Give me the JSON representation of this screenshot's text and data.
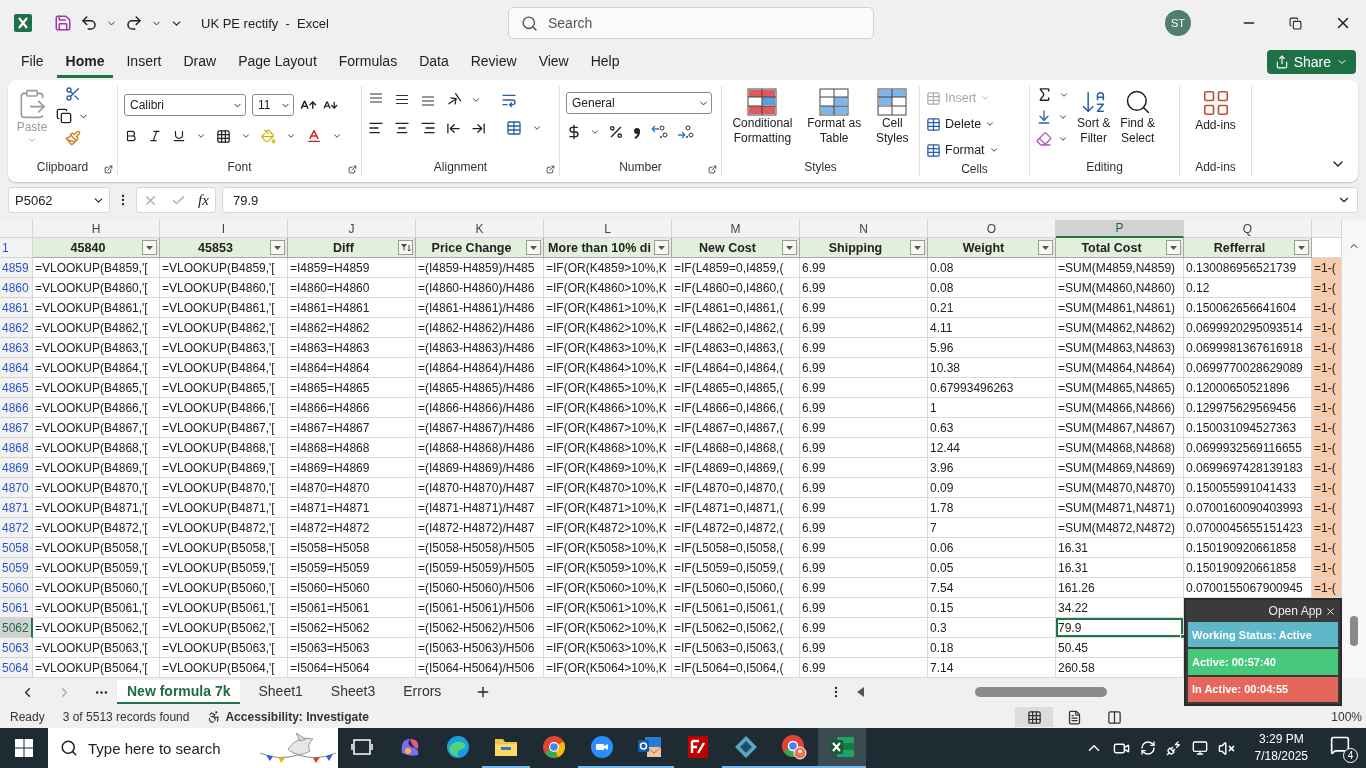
{
  "title_bar": {
    "document_title": "UK PE rectify  -  Excel",
    "search_placeholder": "Search",
    "avatar": "ST"
  },
  "menu_tabs": [
    {
      "label": "File",
      "selected": false
    },
    {
      "label": "Home",
      "selected": true
    },
    {
      "label": "Insert",
      "selected": false
    },
    {
      "label": "Draw",
      "selected": false
    },
    {
      "label": "Page Layout",
      "selected": false
    },
    {
      "label": "Formulas",
      "selected": false
    },
    {
      "label": "Data",
      "selected": false
    },
    {
      "label": "Review",
      "selected": false
    },
    {
      "label": "View",
      "selected": false
    },
    {
      "label": "Help",
      "selected": false
    }
  ],
  "share_button": "Share",
  "ribbon": {
    "clipboard": {
      "paste": "Paste",
      "label": "Clipboard"
    },
    "font": {
      "name": "Calibri",
      "size": "11",
      "label": "Font"
    },
    "alignment": {
      "label": "Alignment"
    },
    "number": {
      "format": "General",
      "label": "Number"
    },
    "styles": {
      "label": "Styles",
      "buttons": [
        {
          "kind": "conditional",
          "lines": [
            "Conditional",
            "Formatting"
          ]
        },
        {
          "kind": "table",
          "lines": [
            "Format as",
            "Table"
          ]
        },
        {
          "kind": "cell",
          "lines": [
            "Cell",
            "Styles"
          ]
        }
      ]
    },
    "cells": {
      "label": "Cells",
      "buttons": [
        {
          "label": "Insert",
          "disabled": true
        },
        {
          "label": "Delete",
          "disabled": false
        },
        {
          "label": "Format",
          "disabled": false
        }
      ]
    },
    "editing": {
      "label": "Editing",
      "buttons": [
        {
          "kind": "sort",
          "lines": [
            "Sort &",
            "Filter"
          ]
        },
        {
          "kind": "find",
          "lines": [
            "Find &",
            "Select"
          ]
        }
      ]
    },
    "add_ins": {
      "button": "Add-ins",
      "label": "Add-ins"
    }
  },
  "formula_bar": {
    "name_box": "P5062",
    "fx": "fx",
    "value": "79.9"
  },
  "sheet": {
    "header_row_number": "1",
    "columns": [
      {
        "letter": "H",
        "header": "45840",
        "filtered": false,
        "selected": false
      },
      {
        "letter": "I",
        "header": "45853",
        "filtered": false,
        "selected": false
      },
      {
        "letter": "J",
        "header": "Diff",
        "filtered": true,
        "selected": false
      },
      {
        "letter": "K",
        "header": "Price Change",
        "filtered": false,
        "selected": false
      },
      {
        "letter": "L",
        "header": "More than 10% di",
        "filtered": false,
        "selected": false
      },
      {
        "letter": "M",
        "header": "New Cost",
        "filtered": false,
        "selected": false
      },
      {
        "letter": "N",
        "header": "Shipping",
        "filtered": false,
        "selected": false
      },
      {
        "letter": "O",
        "header": "Weight",
        "filtered": false,
        "selected": false
      },
      {
        "letter": "P",
        "header": "Total Cost",
        "filtered": false,
        "selected": true
      },
      {
        "letter": "Q",
        "header": "Refferral",
        "filtered": false,
        "selected": false
      },
      {
        "color": "#f8cbad",
        "selected": false
      }
    ],
    "rows": [
      {
        "number": "4859",
        "selected": false,
        "cells": [
          "=VLOOKUP(B4859,'[",
          "=VLOOKUP(B4859,'[",
          "=I4859=H4859",
          "=(I4859-H4859)/H485",
          "=IF(OR(K4859>10%,K",
          "=IF(L4859=0,I4859,(",
          "6.99",
          "0.08",
          "=SUM(M4859,N4859)",
          "0.130086956521739",
          "=1-("
        ]
      },
      {
        "number": "4860",
        "selected": false,
        "cells": [
          "=VLOOKUP(B4860,'[",
          "=VLOOKUP(B4860,'[",
          "=I4860=H4860",
          "=(I4860-H4860)/H486",
          "=IF(OR(K4860>10%,K",
          "=IF(L4860=0,I4860,(",
          "6.99",
          "0.08",
          "=SUM(M4860,N4860)",
          "0.12",
          "=1-("
        ]
      },
      {
        "number": "4861",
        "selected": false,
        "cells": [
          "=VLOOKUP(B4861,'[",
          "=VLOOKUP(B4861,'[",
          "=I4861=H4861",
          "=(I4861-H4861)/H486",
          "=IF(OR(K4861>10%,K",
          "=IF(L4861=0,I4861,(",
          "6.99",
          "0.21",
          "=SUM(M4861,N4861)",
          "0.150062656641604",
          "=1-("
        ]
      },
      {
        "number": "4862",
        "selected": false,
        "cells": [
          "=VLOOKUP(B4862,'[",
          "=VLOOKUP(B4862,'[",
          "=I4862=H4862",
          "=(I4862-H4862)/H486",
          "=IF(OR(K4862>10%,K",
          "=IF(L4862=0,I4862,(",
          "6.99",
          "4.11",
          "=SUM(M4862,N4862)",
          "0.0699920295093514",
          "=1-("
        ]
      },
      {
        "number": "4863",
        "selected": false,
        "cells": [
          "=VLOOKUP(B4863,'[",
          "=VLOOKUP(B4863,'[",
          "=I4863=H4863",
          "=(I4863-H4863)/H486",
          "=IF(OR(K4863>10%,K",
          "=IF(L4863=0,I4863,(",
          "6.99",
          "5.96",
          "=SUM(M4863,N4863)",
          "0.0699981367616918",
          "=1-("
        ]
      },
      {
        "number": "4864",
        "selected": false,
        "cells": [
          "=VLOOKUP(B4864,'[",
          "=VLOOKUP(B4864,'[",
          "=I4864=H4864",
          "=(I4864-H4864)/H486",
          "=IF(OR(K4864>10%,K",
          "=IF(L4864=0,I4864,(",
          "6.99",
          "10.38",
          "=SUM(M4864,N4864)",
          "0.0699770028629089",
          "=1-("
        ]
      },
      {
        "number": "4865",
        "selected": false,
        "cells": [
          "=VLOOKUP(B4865,'[",
          "=VLOOKUP(B4865,'[",
          "=I4865=H4865",
          "=(I4865-H4865)/H486",
          "=IF(OR(K4865>10%,K",
          "=IF(L4865=0,I4865,(",
          "6.99",
          "0.67993496263",
          "=SUM(M4865,N4865)",
          "0.12000650521896",
          "=1-("
        ]
      },
      {
        "number": "4866",
        "selected": false,
        "cells": [
          "=VLOOKUP(B4866,'[",
          "=VLOOKUP(B4866,'[",
          "=I4866=H4866",
          "=(I4866-H4866)/H486",
          "=IF(OR(K4866>10%,K",
          "=IF(L4866=0,I4866,(",
          "6.99",
          "1",
          "=SUM(M4866,N4866)",
          "0.129975629569456",
          "=1-("
        ]
      },
      {
        "number": "4867",
        "selected": false,
        "cells": [
          "=VLOOKUP(B4867,'[",
          "=VLOOKUP(B4867,'[",
          "=I4867=H4867",
          "=(I4867-H4867)/H486",
          "=IF(OR(K4867>10%,K",
          "=IF(L4867=0,I4867,(",
          "6.99",
          "0.63",
          "=SUM(M4867,N4867)",
          "0.150031094527363",
          "=1-("
        ]
      },
      {
        "number": "4868",
        "selected": false,
        "cells": [
          "=VLOOKUP(B4868,'[",
          "=VLOOKUP(B4868,'[",
          "=I4868=H4868",
          "=(I4868-H4868)/H486",
          "=IF(OR(K4868>10%,K",
          "=IF(L4868=0,I4868,(",
          "6.99",
          "12.44",
          "=SUM(M4868,N4868)",
          "0.0699932569116655",
          "=1-("
        ]
      },
      {
        "number": "4869",
        "selected": false,
        "cells": [
          "=VLOOKUP(B4869,'[",
          "=VLOOKUP(B4869,'[",
          "=I4869=H4869",
          "=(I4869-H4869)/H486",
          "=IF(OR(K4869>10%,K",
          "=IF(L4869=0,I4869,(",
          "6.99",
          "3.96",
          "=SUM(M4869,N4869)",
          "0.0699697428139183",
          "=1-("
        ]
      },
      {
        "number": "4870",
        "selected": false,
        "cells": [
          "=VLOOKUP(B4870,'[",
          "=VLOOKUP(B4870,'[",
          "=I4870=H4870",
          "=(I4870-H4870)/H487",
          "=IF(OR(K4870>10%,K",
          "=IF(L4870=0,I4870,(",
          "6.99",
          "0.09",
          "=SUM(M4870,N4870)",
          "0.150055991041433",
          "=1-("
        ]
      },
      {
        "number": "4871",
        "selected": false,
        "cells": [
          "=VLOOKUP(B4871,'[",
          "=VLOOKUP(B4871,'[",
          "=I4871=H4871",
          "=(I4871-H4871)/H487",
          "=IF(OR(K4871>10%,K",
          "=IF(L4871=0,I4871,(",
          "6.99",
          "1.78",
          "=SUM(M4871,N4871)",
          "0.0700160090403993",
          "=1-("
        ]
      },
      {
        "number": "4872",
        "selected": false,
        "cells": [
          "=VLOOKUP(B4872,'[",
          "=VLOOKUP(B4872,'[",
          "=I4872=H4872",
          "=(I4872-H4872)/H487",
          "=IF(OR(K4872>10%,K",
          "=IF(L4872=0,I4872,(",
          "6.99",
          "7",
          "=SUM(M4872,N4872)",
          "0.0700045655151423",
          "=1-("
        ]
      },
      {
        "number": "5058",
        "selected": false,
        "cells": [
          "=VLOOKUP(B5058,'[",
          "=VLOOKUP(B5058,'[",
          "=I5058=H5058",
          "=(I5058-H5058)/H505",
          "=IF(OR(K5058>10%,K",
          "=IF(L5058=0,I5058,(",
          "6.99",
          "0.06",
          "16.31",
          "0.150190920661858",
          "=1-("
        ]
      },
      {
        "number": "5059",
        "selected": false,
        "cells": [
          "=VLOOKUP(B5059,'[",
          "=VLOOKUP(B5059,'[",
          "=I5059=H5059",
          "=(I5059-H5059)/H505",
          "=IF(OR(K5059>10%,K",
          "=IF(L5059=0,I5059,(",
          "6.99",
          "0.05",
          "16.31",
          "0.150190920661858",
          "=1-("
        ]
      },
      {
        "number": "5060",
        "selected": false,
        "cells": [
          "=VLOOKUP(B5060,'[",
          "=VLOOKUP(B5060,'[",
          "=I5060=H5060",
          "=(I5060-H5060)/H506",
          "=IF(OR(K5060>10%,K",
          "=IF(L5060=0,I5060,(",
          "6.99",
          "7.54",
          "161.26",
          "0.0700155067900945",
          "=1-("
        ]
      },
      {
        "number": "5061",
        "selected": false,
        "cells": [
          "=VLOOKUP(B5061,'[",
          "=VLOOKUP(B5061,'[",
          "=I5061=H5061",
          "=(I5061-H5061)/H506",
          "=IF(OR(K5061>10%,K",
          "=IF(L5061=0,I5061,(",
          "6.99",
          "0.15",
          "34.22"
        ]
      },
      {
        "number": "5062",
        "selected": true,
        "cells": [
          "=VLOOKUP(B5062,'[",
          "=VLOOKUP(B5062,'[",
          "=I5062=H5062",
          "=(I5062-H5062)/H506",
          "=IF(OR(K5062>10%,K",
          "=IF(L5062=0,I5062,(",
          "6.99",
          "0.3",
          "79.9"
        ]
      },
      {
        "number": "5063",
        "selected": false,
        "cells": [
          "=VLOOKUP(B5063,'[",
          "=VLOOKUP(B5063,'[",
          "=I5063=H5063",
          "=(I5063-H5063)/H506",
          "=IF(OR(K5063>10%,K",
          "=IF(L5063=0,I5063,(",
          "6.99",
          "0.18",
          "50.45"
        ]
      },
      {
        "number": "5064",
        "selected": false,
        "cells": [
          "=VLOOKUP(B5064,'[",
          "=VLOOKUP(B5064,'[",
          "=I5064=H5064",
          "=(I5064-H5064)/H506",
          "=IF(OR(K5064>10%,K",
          "=IF(L5064=0,I5064,(",
          "6.99",
          "7.14",
          "260.58"
        ]
      }
    ]
  },
  "sheet_tabs": [
    {
      "label": "New formula 7k",
      "selected": true
    },
    {
      "label": "Sheet1",
      "selected": false
    },
    {
      "label": "Sheet3",
      "selected": false
    },
    {
      "label": "Errors",
      "selected": false
    }
  ],
  "status_bar": {
    "mode": "Ready",
    "records": "3 of 5513 records found",
    "accessibility": "Accessibility: Investigate",
    "views": [
      {
        "kind": "normal",
        "selected": true
      },
      {
        "kind": "page_layout",
        "selected": false
      },
      {
        "kind": "page_break",
        "selected": false
      }
    ],
    "zoom": "100%"
  },
  "tracker_widget": {
    "open_app": "Open App",
    "status": "Working Status: Active",
    "active": "Active: 00:57:40",
    "inactive": "In Active: 00:04:55"
  },
  "taskbar": {
    "search_placeholder": "Type here to search",
    "apps": [
      {
        "kind": "task_view",
        "open": false,
        "selected": false
      },
      {
        "kind": "copilot",
        "open": false,
        "selected": false
      },
      {
        "kind": "edge",
        "open": false,
        "selected": false
      },
      {
        "kind": "files",
        "open": true,
        "selected": false
      },
      {
        "kind": "chrome",
        "open": false,
        "selected": false
      },
      {
        "kind": "zoom",
        "open": true,
        "selected": false
      },
      {
        "kind": "outlook",
        "open": true,
        "selected": false
      },
      {
        "kind": "filezilla",
        "open": false,
        "selected": false
      },
      {
        "kind": "diamond",
        "open": true,
        "selected": false
      },
      {
        "kind": "chrome_profile",
        "open": true,
        "selected": false
      },
      {
        "kind": "excel",
        "open": true,
        "selected": true
      }
    ],
    "time": "3:29 PM",
    "date": "7/18/2025",
    "notifications": "4"
  }
}
